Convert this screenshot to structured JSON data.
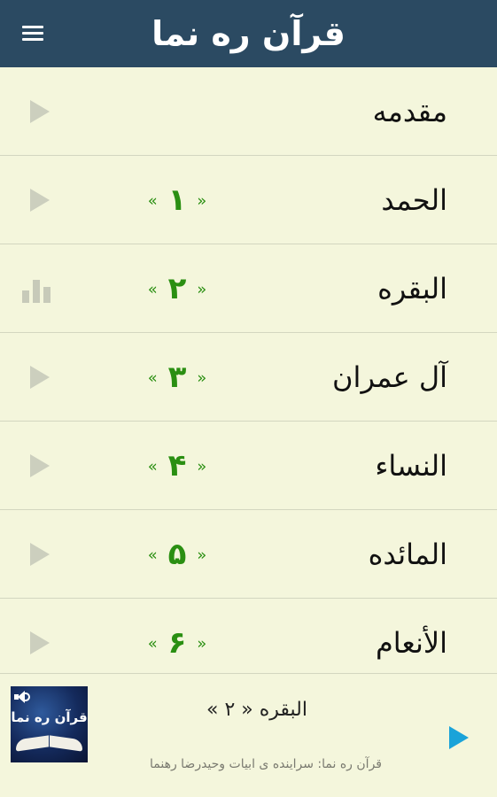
{
  "app_bar": {
    "title": "قرآن ره نما",
    "menu_icon": "menu-icon"
  },
  "colors": {
    "app_bar": "#2b4a62",
    "background": "#f4f6dc",
    "surah_number": "#2a8f12",
    "player_play": "#1aa3d9",
    "row_icon": "#cccfbe"
  },
  "list": {
    "items": [
      {
        "title": "مقدمه",
        "number": "",
        "icon": "play-icon"
      },
      {
        "title": "الحمد",
        "number": "۱",
        "icon": "play-icon"
      },
      {
        "title": "البقره",
        "number": "۲",
        "icon": "bar-chart-icon"
      },
      {
        "title": "آل عمران",
        "number": "۳",
        "icon": "play-icon"
      },
      {
        "title": "النساء",
        "number": "۴",
        "icon": "play-icon"
      },
      {
        "title": "المائده",
        "number": "۵",
        "icon": "play-icon"
      },
      {
        "title": "الأنعام",
        "number": "۶",
        "icon": "play-icon"
      }
    ]
  },
  "player": {
    "now_playing": "البقره « ۲ »",
    "credit": "قرآن ره نما: سراینده ی ابیات وحیدرضا رهنما",
    "cover_title": "قرآن ره نما",
    "play_icon": "play-icon"
  }
}
